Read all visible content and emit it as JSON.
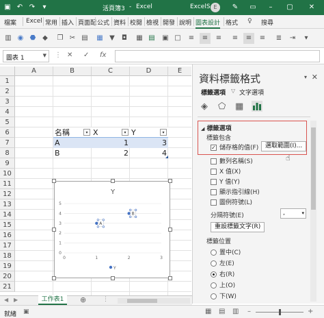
{
  "title_bar": {
    "filename": "活頁簿3",
    "separator": "-",
    "app": "Excel",
    "tools_label": "Excel‌S",
    "user_initial": "E"
  },
  "ribbon_tabs": [
    "檔案",
    "Excel",
    "常用",
    "插入",
    "頁面配",
    "公式",
    "資料",
    "校閱",
    "檢視",
    "開發",
    "說明",
    "圖表設計",
    "格式"
  ],
  "search_label": "搜尋",
  "formula_bar": {
    "name_box": "圖表 1",
    "fx": "fx"
  },
  "columns": [
    "A",
    "B",
    "C",
    "D",
    "E"
  ],
  "rows": [
    "1",
    "2",
    "3",
    "4",
    "5",
    "6",
    "7",
    "8",
    "9",
    "10",
    "11",
    "12",
    "13",
    "14",
    "15",
    "16",
    "17",
    "18",
    "19",
    "20",
    "21"
  ],
  "table": {
    "headers": [
      "名稱",
      "X",
      "Y"
    ],
    "rows": [
      {
        "name": "A",
        "x": "1",
        "y": "3"
      },
      {
        "name": "B",
        "x": "2",
        "y": "4"
      }
    ]
  },
  "chart": {
    "title": "Y",
    "legend": "Y",
    "x_ticks": [
      "0",
      "1",
      "2",
      "3"
    ],
    "y_ticks": [
      "0",
      "1",
      "2",
      "3",
      "4",
      "5"
    ],
    "data_labels": [
      "A",
      "B"
    ]
  },
  "chart_data": {
    "type": "scatter",
    "title": "Y",
    "series": [
      {
        "name": "Y",
        "x": [
          1,
          2
        ],
        "y": [
          3,
          4
        ],
        "labels": [
          "A",
          "B"
        ]
      }
    ],
    "xlim": [
      0,
      3
    ],
    "ylim": [
      0,
      5
    ],
    "legend": "bottom"
  },
  "pane": {
    "title": "資料標籤格式",
    "tab_label_options": "標籤選項",
    "tab_text_options": "文字選項",
    "section_label_options": "標籤選項",
    "label_contains": "標籤包含",
    "opt_cell_value": "儲存格的值(F)",
    "btn_select_range": "選取範圍(I)...",
    "opt_series_name": "數列名稱(S)",
    "opt_x_value": "X 值(X)",
    "opt_y_value": "Y 值(Y)",
    "opt_leader_lines": "顯示指引線(H)",
    "opt_legend_key": "圖例符號(L)",
    "separator_label": "分隔符號(E)",
    "separator_value": ",",
    "btn_reset": "重設標籤文字(R)",
    "label_position": "標籤位置",
    "pos_center": "置中(C)",
    "pos_left": "左(E)",
    "pos_right": "右(R)",
    "pos_above": "上(O)",
    "pos_below": "下(W)"
  },
  "sheet_tab": "工作表1",
  "status": "就緒",
  "colors": {
    "brand": "#217346",
    "highlight": "#d9534f",
    "band": "#dbe5f5"
  }
}
